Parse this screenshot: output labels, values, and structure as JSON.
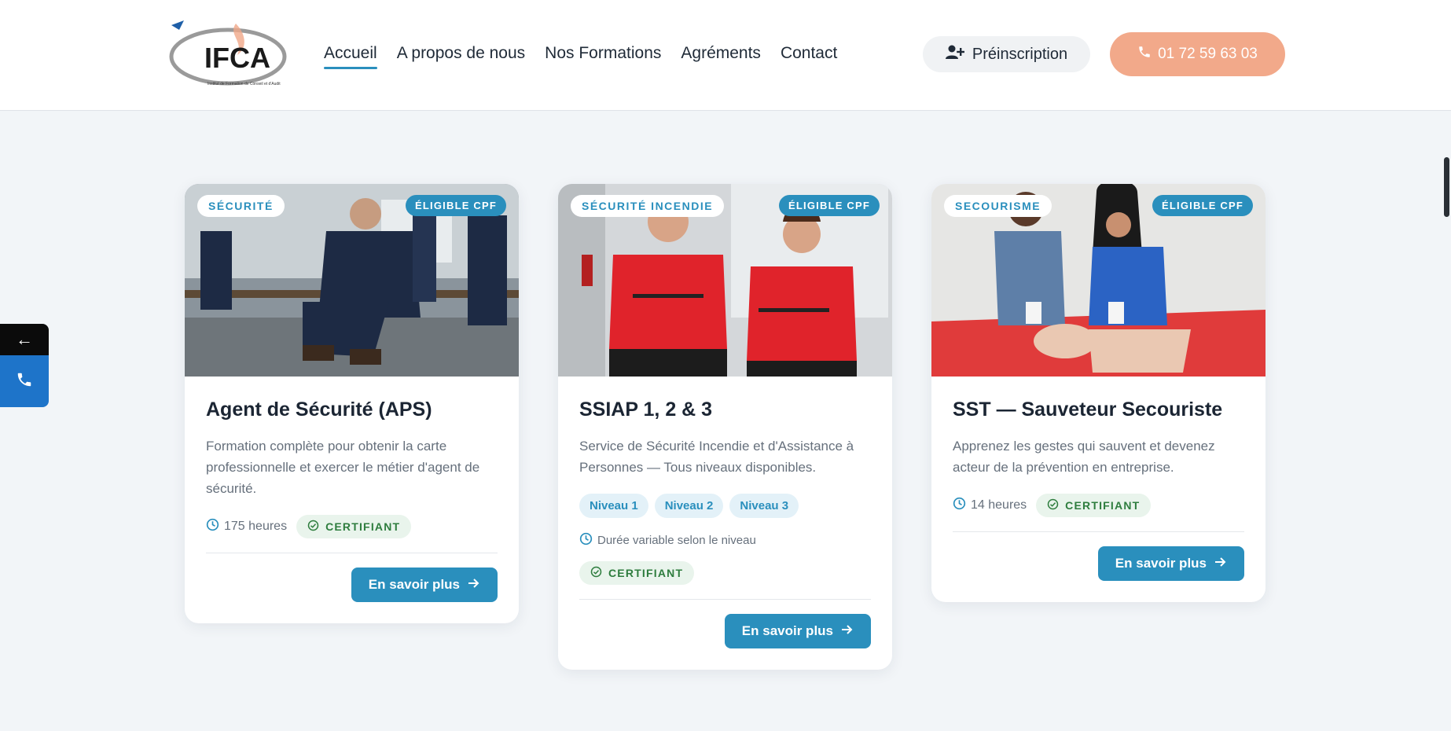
{
  "header": {
    "logo_text": "IFCA",
    "logo_subtext": "Institut de Formation de Conseil et d'Audit",
    "nav": [
      {
        "label": "Accueil",
        "active": true
      },
      {
        "label": "A propos de nous"
      },
      {
        "label": "Nos Formations"
      },
      {
        "label": "Agréments"
      },
      {
        "label": "Contact"
      }
    ],
    "preinscription_label": "Préinscription",
    "phone_label": "01 72 59 63 03"
  },
  "side_widget": {
    "back_glyph": "←"
  },
  "colors": {
    "accent": "#2a8fbd",
    "phone_button": "#f2a98a",
    "certifiant": "#2e7d3e",
    "side_phone": "#1e74c9"
  },
  "cards": [
    {
      "category": "SÉCURITÉ",
      "cpf": "ÉLIGIBLE CPF",
      "title": "Agent de Sécurité (APS)",
      "description": "Formation complète pour obtenir la carte professionnelle et exercer le métier d'agent de sécurité.",
      "hours": "175 heures",
      "cert": "CERTIFIANT",
      "button": "En savoir plus"
    },
    {
      "category": "SÉCURITÉ INCENDIE",
      "cpf": "ÉLIGIBLE CPF",
      "title": "SSIAP 1, 2 & 3",
      "description": "Service de Sécurité Incendie et d'Assistance à Personnes — Tous niveaux disponibles.",
      "levels": [
        "Niveau 1",
        "Niveau 2",
        "Niveau 3"
      ],
      "duration": "Durée variable selon le niveau",
      "cert": "CERTIFIANT",
      "button": "En savoir plus"
    },
    {
      "category": "SECOURISME",
      "cpf": "ÉLIGIBLE CPF",
      "title": "SST — Sauveteur Secouriste",
      "description": "Apprenez les gestes qui sauvent et devenez acteur de la prévention en entreprise.",
      "hours": "14 heures",
      "cert": "CERTIFIANT",
      "button": "En savoir plus"
    }
  ]
}
